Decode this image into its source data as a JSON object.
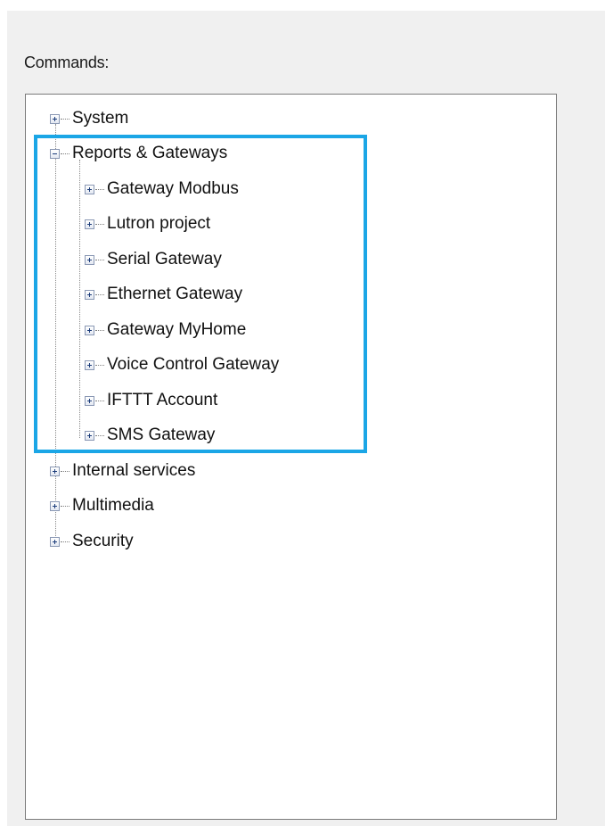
{
  "commands_label": "Commands:",
  "tree": {
    "items": [
      {
        "label": "System",
        "expanded": false,
        "icon": "plus-icon"
      },
      {
        "label": "Reports & Gateways",
        "expanded": true,
        "icon": "minus-icon",
        "children": [
          {
            "label": "Gateway Modbus",
            "icon": "plus-icon"
          },
          {
            "label": "Lutron project",
            "icon": "plus-icon"
          },
          {
            "label": "Serial Gateway",
            "icon": "plus-icon"
          },
          {
            "label": "Ethernet Gateway",
            "icon": "plus-icon"
          },
          {
            "label": "Gateway MyHome",
            "icon": "plus-icon"
          },
          {
            "label": "Voice Control Gateway",
            "icon": "plus-icon"
          },
          {
            "label": "IFTTT Account",
            "icon": "plus-icon"
          },
          {
            "label": "SMS Gateway",
            "icon": "plus-icon"
          }
        ]
      },
      {
        "label": "Internal services",
        "expanded": false,
        "icon": "plus-icon"
      },
      {
        "label": "Multimedia",
        "expanded": false,
        "icon": "plus-icon"
      },
      {
        "label": "Security",
        "expanded": false,
        "icon": "plus-icon"
      }
    ]
  },
  "colors": {
    "highlight": "#1ba6e6",
    "panel_background": "#f0f0f0",
    "tree_background": "#ffffff"
  }
}
